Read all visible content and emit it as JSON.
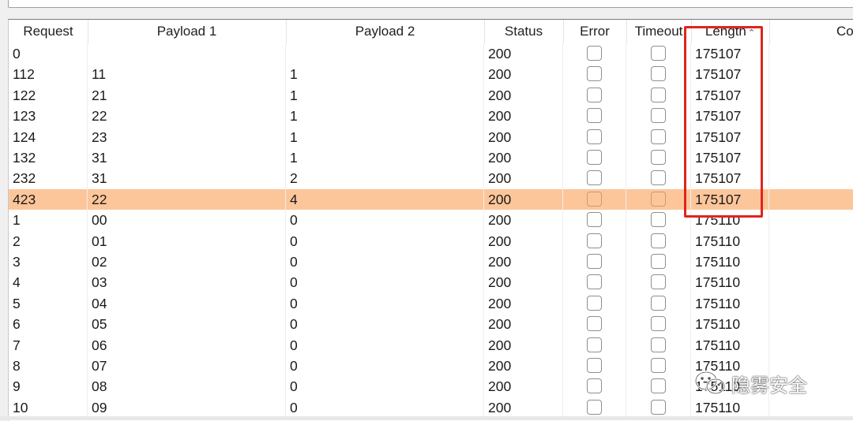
{
  "columns": [
    {
      "label": "Request"
    },
    {
      "label": "Payload 1"
    },
    {
      "label": "Payload 2"
    },
    {
      "label": "Status"
    },
    {
      "label": "Error"
    },
    {
      "label": "Timeout"
    },
    {
      "label": "Length"
    },
    {
      "label": "Co"
    }
  ],
  "sort": {
    "column": "Length",
    "direction": "ascending"
  },
  "rows": [
    {
      "request": "0",
      "payload1": "",
      "payload2": "",
      "status": "200",
      "error": false,
      "timeout": false,
      "length": "175107",
      "selected": false
    },
    {
      "request": "112",
      "payload1": "11",
      "payload2": "1",
      "status": "200",
      "error": false,
      "timeout": false,
      "length": "175107",
      "selected": false
    },
    {
      "request": "122",
      "payload1": "21",
      "payload2": "1",
      "status": "200",
      "error": false,
      "timeout": false,
      "length": "175107",
      "selected": false
    },
    {
      "request": "123",
      "payload1": "22",
      "payload2": "1",
      "status": "200",
      "error": false,
      "timeout": false,
      "length": "175107",
      "selected": false
    },
    {
      "request": "124",
      "payload1": "23",
      "payload2": "1",
      "status": "200",
      "error": false,
      "timeout": false,
      "length": "175107",
      "selected": false
    },
    {
      "request": "132",
      "payload1": "31",
      "payload2": "1",
      "status": "200",
      "error": false,
      "timeout": false,
      "length": "175107",
      "selected": false
    },
    {
      "request": "232",
      "payload1": "31",
      "payload2": "2",
      "status": "200",
      "error": false,
      "timeout": false,
      "length": "175107",
      "selected": false
    },
    {
      "request": "423",
      "payload1": "22",
      "payload2": "4",
      "status": "200",
      "error": false,
      "timeout": false,
      "length": "175107",
      "selected": true
    },
    {
      "request": "1",
      "payload1": "00",
      "payload2": "0",
      "status": "200",
      "error": false,
      "timeout": false,
      "length": "175110",
      "selected": false
    },
    {
      "request": "2",
      "payload1": "01",
      "payload2": "0",
      "status": "200",
      "error": false,
      "timeout": false,
      "length": "175110",
      "selected": false
    },
    {
      "request": "3",
      "payload1": "02",
      "payload2": "0",
      "status": "200",
      "error": false,
      "timeout": false,
      "length": "175110",
      "selected": false
    },
    {
      "request": "4",
      "payload1": "03",
      "payload2": "0",
      "status": "200",
      "error": false,
      "timeout": false,
      "length": "175110",
      "selected": false
    },
    {
      "request": "5",
      "payload1": "04",
      "payload2": "0",
      "status": "200",
      "error": false,
      "timeout": false,
      "length": "175110",
      "selected": false
    },
    {
      "request": "6",
      "payload1": "05",
      "payload2": "0",
      "status": "200",
      "error": false,
      "timeout": false,
      "length": "175110",
      "selected": false
    },
    {
      "request": "7",
      "payload1": "06",
      "payload2": "0",
      "status": "200",
      "error": false,
      "timeout": false,
      "length": "175110",
      "selected": false
    },
    {
      "request": "8",
      "payload1": "07",
      "payload2": "0",
      "status": "200",
      "error": false,
      "timeout": false,
      "length": "175110",
      "selected": false
    },
    {
      "request": "9",
      "payload1": "08",
      "payload2": "0",
      "status": "200",
      "error": false,
      "timeout": false,
      "length": "175110",
      "selected": false
    },
    {
      "request": "10",
      "payload1": "09",
      "payload2": "0",
      "status": "200",
      "error": false,
      "timeout": false,
      "length": "175110",
      "selected": false
    }
  ],
  "annotation": {
    "color": "#e0241b"
  },
  "watermark": {
    "text": "隐雾安全",
    "icon": "wechat-icon"
  },
  "colors": {
    "selected_row": "#fdc69a",
    "highlight": "#e0241b"
  }
}
